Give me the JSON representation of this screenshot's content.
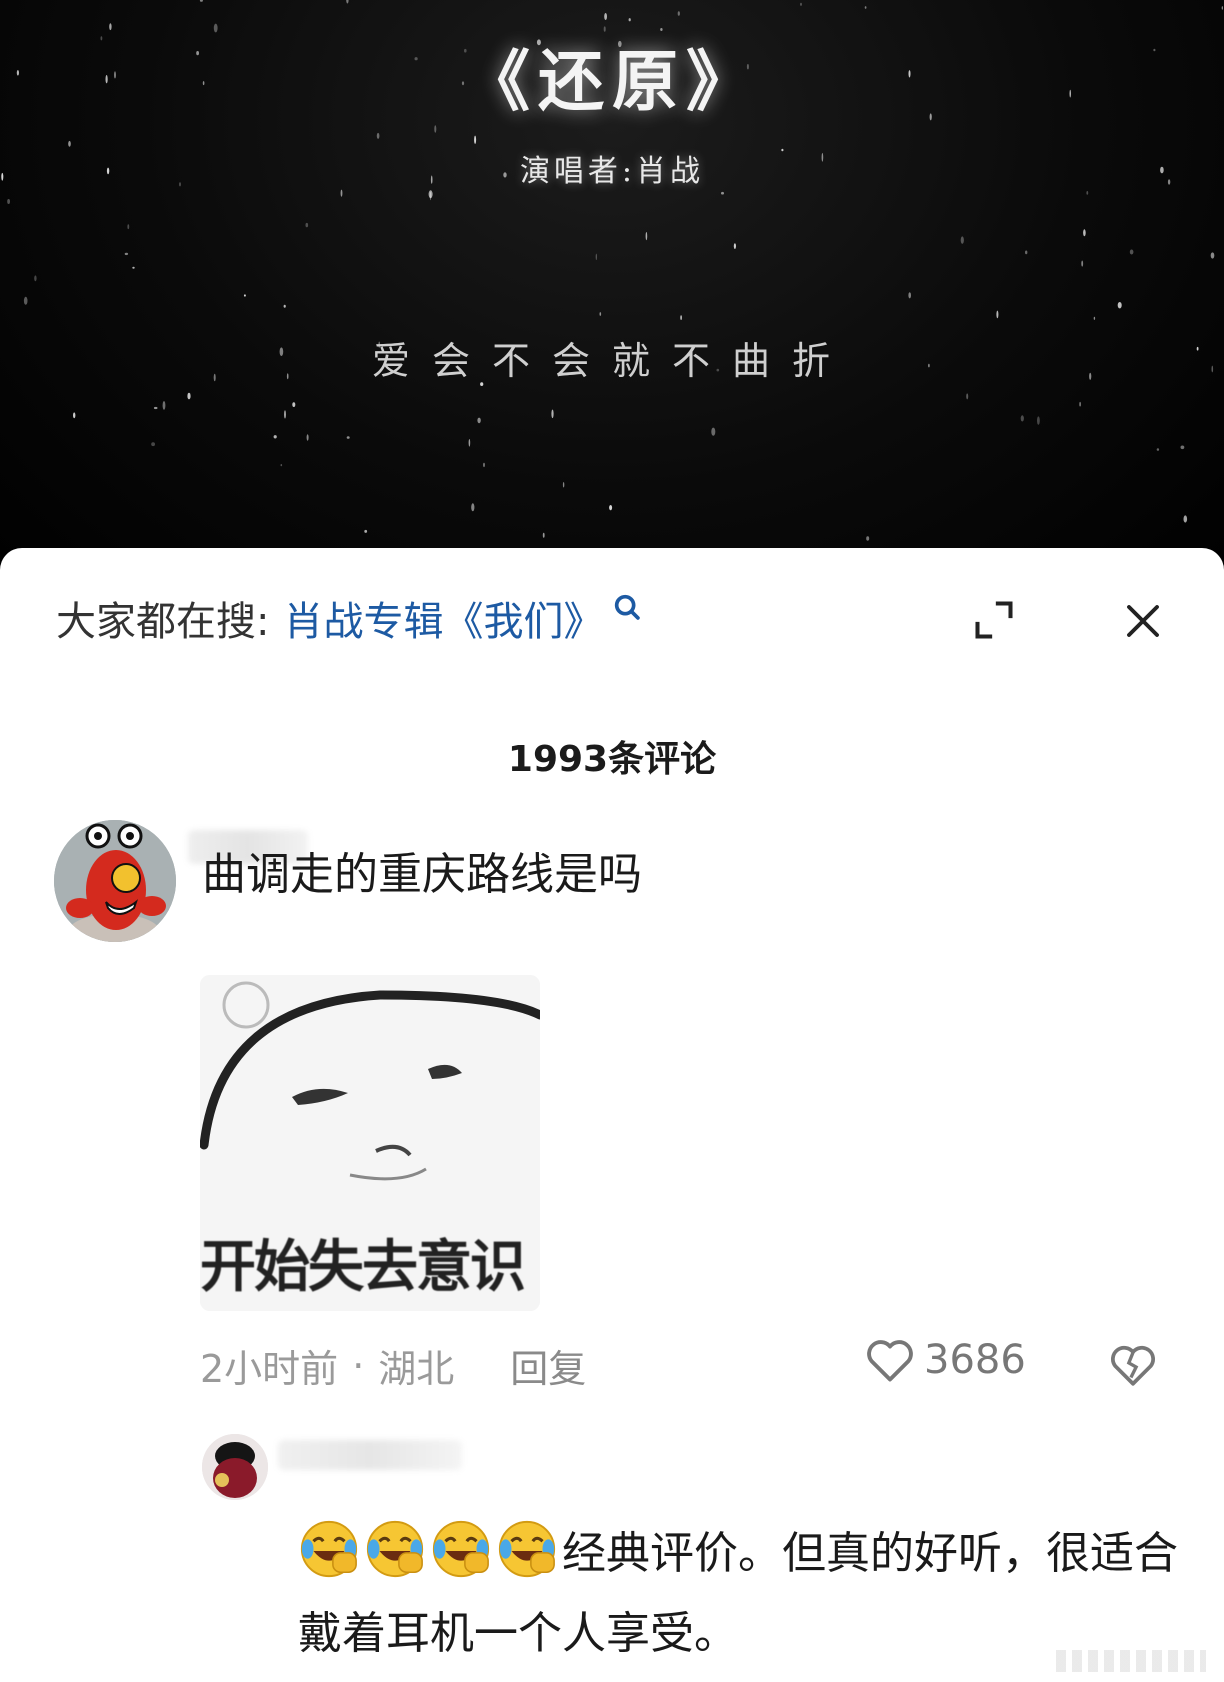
{
  "video": {
    "song_title": "《还原》",
    "singer": "演唱者:肖战",
    "lyric": "爱会不会就不曲折"
  },
  "search_bar": {
    "prefix": "大家都在搜:",
    "term": "肖战专辑《我们》",
    "icon": "search-icon"
  },
  "comments_header": {
    "count_label": "1993条评论"
  },
  "comments": [
    {
      "text": "曲调走的重庆路线是吗",
      "meme_caption": "开始失去意识",
      "time": "2小时前",
      "location": "湖北",
      "reply_label": "回复",
      "likes": "3686",
      "reply": {
        "text": "经典评价。但真的好听，很适合戴着耳机一个人享受。",
        "emoji": "laughing-crying-emoji",
        "emoji_count": 4
      }
    }
  ],
  "colors": {
    "search_term": "#1d5aa3",
    "meta_text": "#9a9a9a",
    "video_bg": "#000000"
  }
}
